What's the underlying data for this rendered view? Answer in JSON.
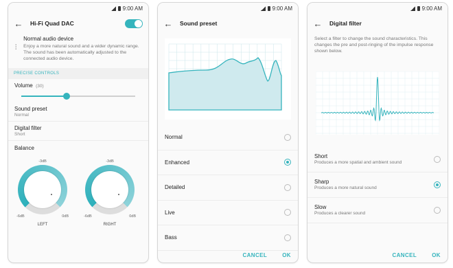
{
  "status": {
    "time": "9:00 AM"
  },
  "screen1": {
    "title": "Hi-Fi Quad DAC",
    "normal_title": "Normal audio device",
    "normal_desc": "Enjoy a more natural sound and a wider dynamic range. The sound has been automatically adjusted to the connected audio device.",
    "section": "PRECISE CONTROLS",
    "volume_label": "Volume",
    "volume_value": "(30)",
    "volume_fraction": 0.44,
    "sound_preset_label": "Sound preset",
    "sound_preset_value": "Normal",
    "digital_filter_label": "Digital filter",
    "digital_filter_value": "Short",
    "balance_label": "Balance",
    "left": {
      "top": "-3dB",
      "min": "-6dB",
      "max": "0dB",
      "name": "LEFT"
    },
    "right": {
      "top": "-3dB",
      "min": "-6dB",
      "max": "0dB",
      "name": "RIGHT"
    }
  },
  "screen2": {
    "title": "Sound preset",
    "options": [
      {
        "label": "Normal",
        "selected": false
      },
      {
        "label": "Enhanced",
        "selected": true
      },
      {
        "label": "Detailed",
        "selected": false
      },
      {
        "label": "Live",
        "selected": false
      },
      {
        "label": "Bass",
        "selected": false
      }
    ],
    "cancel": "CANCEL",
    "ok": "OK"
  },
  "screen3": {
    "title": "Digital filter",
    "desc": "Select a filter to change the sound characteristics. This changes the pre and post-ringing of the impulse response shown below.",
    "options": [
      {
        "name": "Short",
        "desc": "Produces a more spatial and ambient sound",
        "selected": false
      },
      {
        "name": "Sharp",
        "desc": "Produces a more natural sound",
        "selected": true
      },
      {
        "name": "Slow",
        "desc": "Produces a clearer sound",
        "selected": false
      }
    ],
    "cancel": "CANCEL",
    "ok": "OK"
  },
  "colors": {
    "accent": "#35b4bd"
  }
}
